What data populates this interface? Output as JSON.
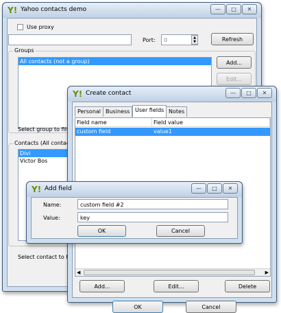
{
  "main_window": {
    "title": "Yahoo contacts demo",
    "use_proxy_label": "Use proxy",
    "port_label": "Port:",
    "port_value": "0",
    "refresh_label": "Refresh",
    "groups_title": "Groups",
    "groups": [
      "All contacts (not a group)"
    ],
    "groups_add_label": "Add...",
    "groups_edit_label": "Edit...",
    "select_group_text": "Select group to filter",
    "contacts_title": "Contacts (All contacts)",
    "contacts": [
      "Divi",
      "Victor Bos"
    ],
    "select_contact_text": "Select contact to hig"
  },
  "create_contact": {
    "title": "Create contact",
    "tabs": [
      "Personal",
      "Business",
      "User fields",
      "Notes"
    ],
    "columns": [
      "Field name",
      "Field value"
    ],
    "rows": [
      {
        "name": "custom field",
        "value": "value1"
      }
    ],
    "add_label": "Add...",
    "edit_label": "Edit...",
    "delete_label": "Delete",
    "ok_label": "OK",
    "cancel_label": "Cancel"
  },
  "add_field": {
    "title": "Add field",
    "name_label": "Name:",
    "name_value": "custom field #2",
    "value_label": "Value:",
    "value_value": "key",
    "ok_label": "OK",
    "cancel_label": "Cancel"
  },
  "window_buttons": {
    "minimize": "—",
    "maximize": "□",
    "close": "✕"
  },
  "app_icon": "yahoo-icon"
}
